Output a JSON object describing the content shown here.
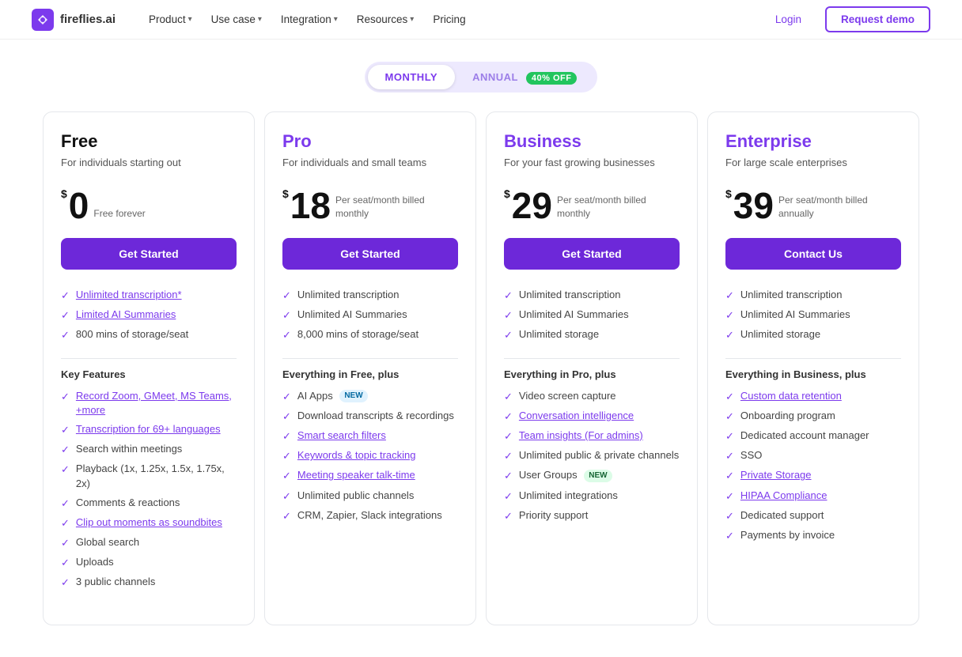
{
  "nav": {
    "logo_text": "fireflies.ai",
    "links": [
      {
        "label": "Product",
        "has_chevron": true
      },
      {
        "label": "Use case",
        "has_chevron": true
      },
      {
        "label": "Integration",
        "has_chevron": true
      },
      {
        "label": "Resources",
        "has_chevron": true
      },
      {
        "label": "Pricing",
        "has_chevron": false
      }
    ],
    "login_label": "Login",
    "demo_label": "Request demo"
  },
  "toggle": {
    "monthly_label": "MONTHLY",
    "annual_label": "ANNUAL",
    "badge_label": "40% OFF",
    "active": "monthly"
  },
  "plans": [
    {
      "id": "free",
      "name": "Free",
      "description": "For individuals starting out",
      "price_dollar": "$",
      "price_amount": "0",
      "price_detail": "Free forever",
      "cta_label": "Get Started",
      "top_features": [
        {
          "text": "Unlimited transcription*",
          "link": true
        },
        {
          "text": "Limited AI Summaries",
          "link": true
        },
        {
          "text": "800 mins of storage/seat",
          "link": false
        }
      ],
      "section_title": "Key Features",
      "key_features": [
        {
          "text": "Record Zoom, GMeet, MS Teams, +more",
          "link": true
        },
        {
          "text": "Transcription for 69+ languages",
          "link": true
        },
        {
          "text": "Search within meetings",
          "link": false
        },
        {
          "text": "Playback (1x, 1.25x, 1.5x, 1.75x, 2x)",
          "link": false
        },
        {
          "text": "Comments & reactions",
          "link": false
        },
        {
          "text": "Clip out moments as soundbites",
          "link": true
        },
        {
          "text": "Global search",
          "link": false
        },
        {
          "text": "Uploads",
          "link": false
        },
        {
          "text": "3 public channels",
          "link": false
        }
      ]
    },
    {
      "id": "pro",
      "name": "Pro",
      "description": "For individuals and small teams",
      "price_dollar": "$",
      "price_amount": "18",
      "price_detail": "Per seat/month billed monthly",
      "cta_label": "Get Started",
      "top_features": [
        {
          "text": "Unlimited transcription",
          "link": false
        },
        {
          "text": "Unlimited AI Summaries",
          "link": false
        },
        {
          "text": "8,000 mins of storage/seat",
          "link": false
        }
      ],
      "section_title": "Everything in Free, plus",
      "key_features": [
        {
          "text": "AI Apps",
          "badge": "NEW",
          "badge_type": "blue",
          "link": false
        },
        {
          "text": "Download transcripts & recordings",
          "link": false
        },
        {
          "text": "Smart search filters",
          "link": true
        },
        {
          "text": "Keywords & topic tracking",
          "link": true
        },
        {
          "text": "Meeting speaker talk-time",
          "link": true
        },
        {
          "text": "Unlimited public channels",
          "link": false
        },
        {
          "text": "CRM, Zapier, Slack integrations",
          "link": false
        }
      ]
    },
    {
      "id": "business",
      "name": "Business",
      "description": "For your fast growing businesses",
      "price_dollar": "$",
      "price_amount": "29",
      "price_detail": "Per seat/month billed monthly",
      "cta_label": "Get Started",
      "top_features": [
        {
          "text": "Unlimited transcription",
          "link": false
        },
        {
          "text": "Unlimited AI Summaries",
          "link": false
        },
        {
          "text": "Unlimited storage",
          "link": false
        }
      ],
      "section_title": "Everything in Pro, plus",
      "key_features": [
        {
          "text": "Video screen capture",
          "link": false
        },
        {
          "text": "Conversation intelligence",
          "link": true
        },
        {
          "text": "Team insights (For admins)",
          "link": true
        },
        {
          "text": "Unlimited public & private channels",
          "link": false
        },
        {
          "text": "User Groups",
          "badge": "NEW",
          "badge_type": "green",
          "link": false
        },
        {
          "text": "Unlimited integrations",
          "link": false
        },
        {
          "text": "Priority support",
          "link": false
        }
      ]
    },
    {
      "id": "enterprise",
      "name": "Enterprise",
      "description": "For large scale enterprises",
      "price_dollar": "$",
      "price_amount": "39",
      "price_detail": "Per seat/month billed annually",
      "cta_label": "Contact Us",
      "top_features": [
        {
          "text": "Unlimited transcription",
          "link": false
        },
        {
          "text": "Unlimited AI Summaries",
          "link": false
        },
        {
          "text": "Unlimited storage",
          "link": false
        }
      ],
      "section_title": "Everything in Business, plus",
      "key_features": [
        {
          "text": "Custom data retention",
          "link": true
        },
        {
          "text": "Onboarding program",
          "link": false
        },
        {
          "text": "Dedicated account manager",
          "link": false
        },
        {
          "text": "SSO",
          "link": false
        },
        {
          "text": "Private Storage",
          "link": true
        },
        {
          "text": "HIPAA Compliance",
          "link": true
        },
        {
          "text": "Dedicated support",
          "link": false
        },
        {
          "text": "Payments by invoice",
          "link": false
        }
      ]
    }
  ]
}
